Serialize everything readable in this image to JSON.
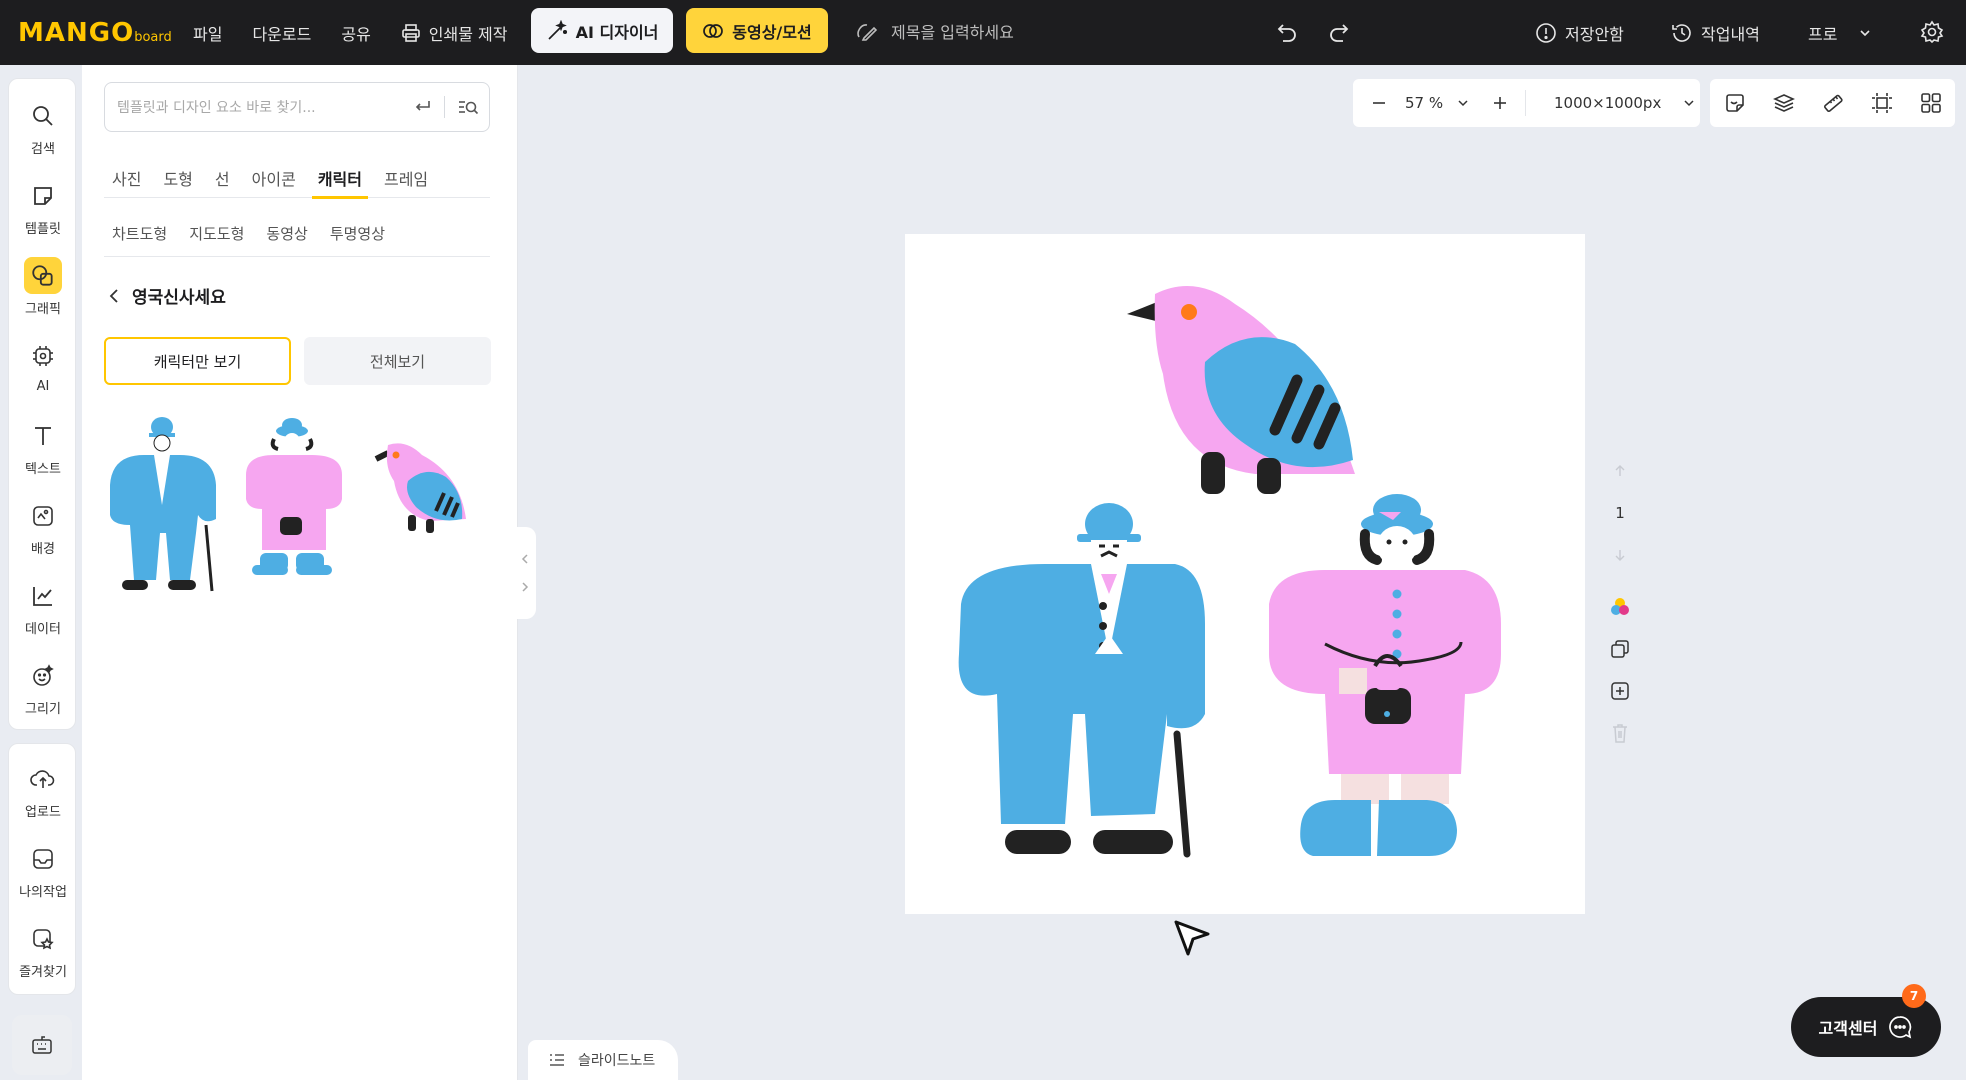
{
  "app": {
    "logo_main": "MANGO",
    "logo_sub": "board"
  },
  "topbar": {
    "menu": [
      "파일",
      "다운로드",
      "공유"
    ],
    "print_label": "인쇄물 제작",
    "ai_designer_label": "AI 디자이너",
    "video_motion_label": "동영상/모션",
    "title_placeholder": "제목을 입력하세요",
    "save_status": "저장안함",
    "history_label": "작업내역",
    "plan_label": "프로"
  },
  "rail": {
    "items": [
      {
        "label": "검색",
        "icon": "search-icon"
      },
      {
        "label": "템플릿",
        "icon": "template-icon"
      },
      {
        "label": "그래픽",
        "icon": "graphic-icon",
        "active": true
      },
      {
        "label": "AI",
        "icon": "ai-icon"
      },
      {
        "label": "텍스트",
        "icon": "text-icon"
      },
      {
        "label": "배경",
        "icon": "background-icon"
      },
      {
        "label": "데이터",
        "icon": "chart-icon"
      },
      {
        "label": "그리기",
        "icon": "draw-icon"
      }
    ],
    "items2": [
      {
        "label": "업로드",
        "icon": "upload-icon"
      },
      {
        "label": "나의작업",
        "icon": "mywork-icon"
      },
      {
        "label": "즐겨찾기",
        "icon": "favorite-icon"
      }
    ]
  },
  "panel": {
    "search_placeholder": "템플릿과 디자인 요소 바로 찾기...",
    "tabs": [
      "사진",
      "도형",
      "선",
      "아이콘",
      "캐릭터",
      "프레임"
    ],
    "active_tab": "캐릭터",
    "subtabs": [
      "차트도형",
      "지도도형",
      "동영상",
      "투명영상"
    ],
    "back_title": "영국신사세요",
    "toggle_characters": "캐릭터만 보기",
    "toggle_all": "전체보기"
  },
  "canvas": {
    "zoom": "57 %",
    "size": "1000×1000px",
    "page_number": "1"
  },
  "footer": {
    "slide_note": "슬라이드노트",
    "help_label": "고객센터",
    "help_badge": "7"
  },
  "colors": {
    "accent": "#ffd43b",
    "topbar": "#1d1d1f",
    "char_blue": "#4eaee3",
    "char_pink": "#f6a6f0",
    "badge": "#ff6a1a"
  }
}
